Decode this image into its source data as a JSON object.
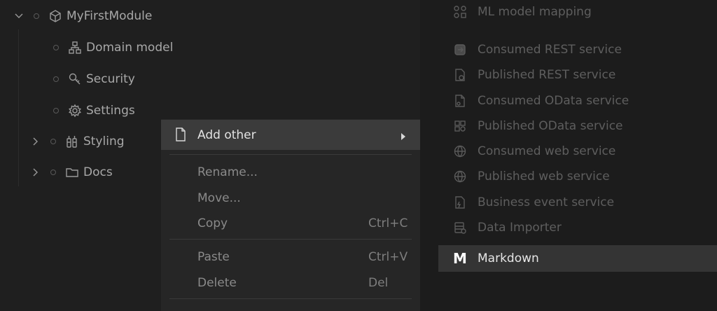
{
  "tree": {
    "items": [
      {
        "label": "MyFirstModule",
        "icon": "module-cube-icon",
        "expanded": true
      },
      {
        "label": "Domain model",
        "icon": "domain-model-icon"
      },
      {
        "label": "Security",
        "icon": "key-icon"
      },
      {
        "label": "Settings",
        "icon": "gear-icon"
      },
      {
        "label": "Styling",
        "icon": "styling-icon",
        "collapsed": true
      },
      {
        "label": "Docs",
        "icon": "folder-icon",
        "collapsed": true
      }
    ]
  },
  "context_menu": {
    "add_other": "Add other",
    "rename": "Rename...",
    "move": "Move...",
    "copy": "Copy",
    "copy_shortcut": "Ctrl+C",
    "paste": "Paste",
    "paste_shortcut": "Ctrl+V",
    "delete": "Delete",
    "delete_shortcut": "Del"
  },
  "submenu": {
    "items": [
      {
        "label": "ML model mapping",
        "icon": "ml-model-icon"
      },
      {
        "label": "Consumed REST service",
        "icon": "consumed-rest-icon"
      },
      {
        "label": "Published REST service",
        "icon": "published-rest-icon"
      },
      {
        "label": "Consumed OData service",
        "icon": "consumed-odata-icon"
      },
      {
        "label": "Published OData service",
        "icon": "published-odata-icon"
      },
      {
        "label": "Consumed web service",
        "icon": "globe-icon"
      },
      {
        "label": "Published web service",
        "icon": "globe-icon"
      },
      {
        "label": "Business event service",
        "icon": "business-event-icon"
      },
      {
        "label": "Data Importer",
        "icon": "data-importer-icon"
      },
      {
        "label": "Markdown",
        "icon": "markdown-icon",
        "glyph": "M"
      }
    ]
  },
  "colors": {
    "background": "#1f1f1f",
    "menu_background": "#262626",
    "menu_highlight": "#3b3b3b",
    "submenu_background": "#1c1c1c",
    "submenu_highlight": "#343434"
  }
}
